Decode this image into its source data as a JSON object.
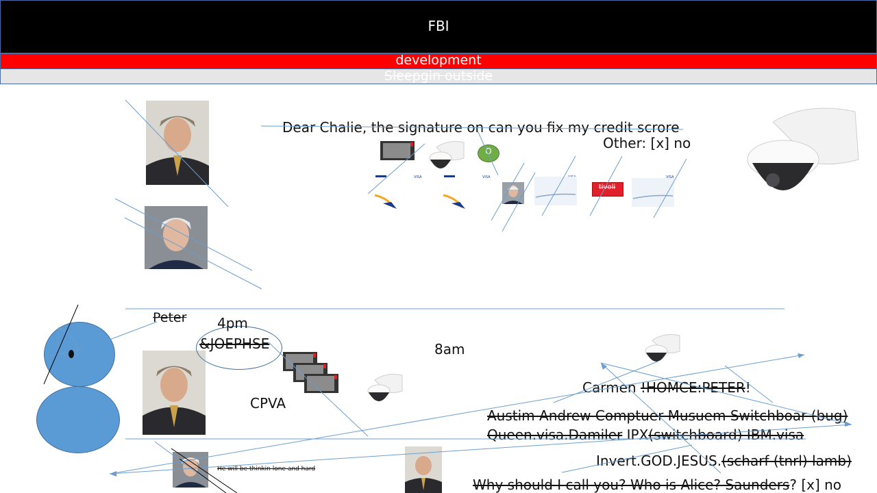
{
  "header": {
    "title": "FBI"
  },
  "bars": {
    "development": "development",
    "sleeping": "Sleepgin outside"
  },
  "top_area": {
    "letter": "Dear Chalie, the signature on can you fix my credit scrore",
    "other": "Other: [x] no",
    "circle_label": "O",
    "visa_label": "VISA",
    "tivoli_label": "tivoli"
  },
  "lower_area": {
    "peter": "Peter",
    "time_4pm": "4pm",
    "joephse": "&JOEPHSE",
    "time_8am": "8am",
    "cpva": "CPVA",
    "carmen": "Carmen",
    "homce_peter": "!HOMCE:PETER",
    "exclaim": "!",
    "austim": "Austim Andrew Comptuer Musuem Switchboar (bug)",
    "queen_struck": "Queen.visa.Damiler",
    "ipx": "IPX",
    "switchboard_struck": "(switchboard) IBM.visa",
    "invert": "Invert.GOD.JESUS.",
    "scharf_struck": "(scharf (tnrl) lamb)",
    "why_struck": "Why should I call you? Who is Alice? Saunders",
    "why_tail": "? [x] no",
    "small_note": "He will be thinkin lone and hard"
  },
  "colors": {
    "accent": "#5b9bd5",
    "line": "#6a9ed0",
    "red": "#ff0000",
    "header_bg": "#000000"
  }
}
